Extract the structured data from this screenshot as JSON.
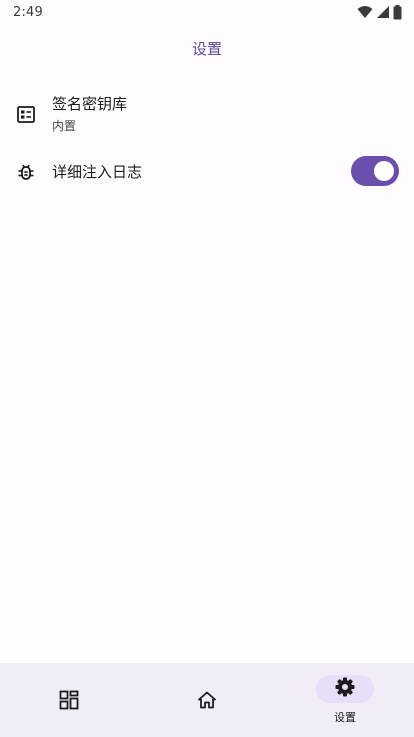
{
  "status_bar": {
    "time": "2:49",
    "icons": [
      "wifi-icon",
      "cellular-icon",
      "battery-icon"
    ]
  },
  "app_bar": {
    "title": "设置"
  },
  "settings": [
    {
      "title": "签名密钥库",
      "subtitle": "内置",
      "icon": "keystore-icon"
    },
    {
      "title": "详细注入日志",
      "icon": "bug-icon",
      "toggle": true
    }
  ],
  "bottom_nav": {
    "items": [
      {
        "icon": "modules-icon",
        "label": ""
      },
      {
        "icon": "home-icon",
        "label": ""
      },
      {
        "icon": "gear-icon",
        "label": "设置",
        "selected": true
      }
    ]
  },
  "colors": {
    "accent": "#6a4fac",
    "title": "#5b4a9b",
    "background": "#fffbfe",
    "nav_background": "#f1ecf5",
    "nav_indicator": "#e8def8"
  }
}
